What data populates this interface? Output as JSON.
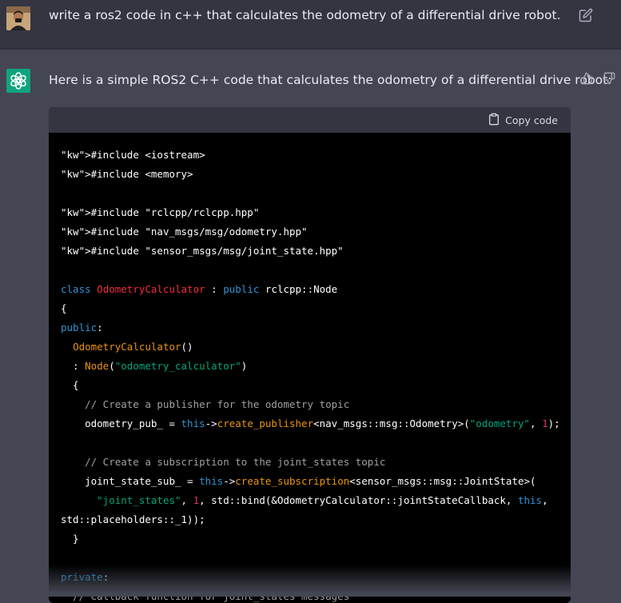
{
  "user_message": {
    "text": "write a ros2 code in c++ that calculates the odometry of a differential drive robot."
  },
  "assistant_message": {
    "intro": "Here is a simple ROS2 C++ code that calculates the odometry of a differential drive robot:",
    "copy_label": "Copy code"
  },
  "code_lines": [
    "#include <iostream>",
    "#include <memory>",
    "",
    "#include \"rclcpp/rclcpp.hpp\"",
    "#include \"nav_msgs/msg/odometry.hpp\"",
    "#include \"sensor_msgs/msg/joint_state.hpp\"",
    "",
    "class OdometryCalculator : public rclcpp::Node",
    "{",
    "public:",
    "  OdometryCalculator()",
    "  : Node(\"odometry_calculator\")",
    "  {",
    "    // Create a publisher for the odometry topic",
    "    odometry_pub_ = this->create_publisher<nav_msgs::msg::Odometry>(\"odometry\", 1);",
    "",
    "    // Create a subscription to the joint_states topic",
    "    joint_state_sub_ = this->create_subscription<sensor_msgs::msg::JointState>(",
    "      \"joint_states\", 1, std::bind(&OdometryCalculator::jointStateCallback, this,",
    "std::placeholders::_1));",
    "  }",
    "",
    "private:",
    "  // Callback function for joint_states messages"
  ],
  "icons": {
    "edit": "edit-icon",
    "thumbs_up": "thumbs-up-icon",
    "thumbs_down": "thumbs-down-icon",
    "clipboard": "clipboard-icon",
    "assistant_logo": "openai-logo-icon"
  },
  "colors": {
    "keyword": "#2e95d3",
    "string": "#00a67d",
    "class_name": "#f22c3d",
    "function": "#e9950c",
    "comment": "#a0a0a0",
    "number": "#df3079",
    "accent": "#10a37f"
  }
}
